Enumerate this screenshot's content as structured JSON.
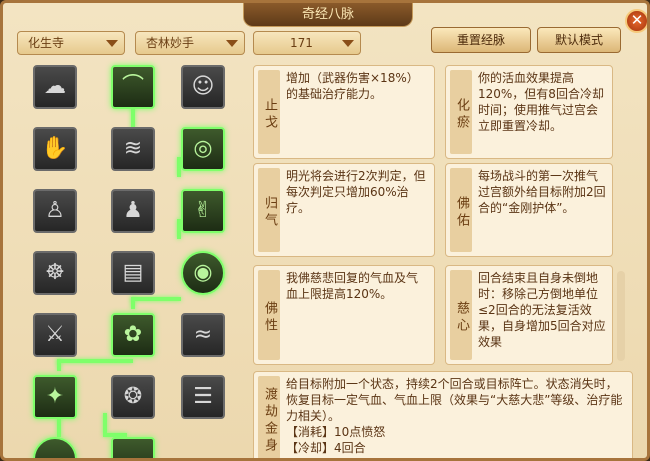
{
  "window": {
    "title": "奇经八脉",
    "close": "✕"
  },
  "filters": [
    {
      "label": "化生寺"
    },
    {
      "label": "杏林妙手"
    },
    {
      "label": "171"
    }
  ],
  "buttons": {
    "reset": "重置经脉",
    "default": "默认模式"
  },
  "skills": [
    {
      "icon": "cloud-icon",
      "glyph": "☁",
      "active": false
    },
    {
      "icon": "green-arch-icon",
      "glyph": "⌒",
      "active": true
    },
    {
      "icon": "monk-icon",
      "glyph": "☺",
      "active": false
    },
    {
      "icon": "hand-icon",
      "glyph": "✋",
      "active": false
    },
    {
      "icon": "jade-ring-icon",
      "glyph": "◎",
      "active": true
    },
    {
      "icon": "wave-icon",
      "glyph": "≋",
      "active": false
    },
    {
      "icon": "buddha-icon",
      "glyph": "♙",
      "active": false
    },
    {
      "icon": "green-hand-icon",
      "glyph": "✌",
      "active": true
    },
    {
      "icon": "figure-icon",
      "glyph": "♟",
      "active": false
    },
    {
      "icon": "meditation-icon",
      "glyph": "☸",
      "active": false
    },
    {
      "icon": "book-icon",
      "glyph": "▤",
      "active": false
    },
    {
      "icon": "halo-icon",
      "glyph": "◉",
      "active": true
    },
    {
      "icon": "sword-icon",
      "glyph": "⚔",
      "active": false
    },
    {
      "icon": "lotus-icon",
      "glyph": "✿",
      "active": true
    },
    {
      "icon": "feather-icon",
      "glyph": "≈",
      "active": false
    },
    {
      "icon": "branch-icon",
      "glyph": "✦",
      "active": true
    },
    {
      "icon": "dragon-icon",
      "glyph": "❂",
      "active": false
    },
    {
      "icon": "scroll-icon",
      "glyph": "☰",
      "active": false
    }
  ],
  "cards": [
    {
      "name": "止戈",
      "desc": "增加（武器伤害×18%）的基础治疗能力。"
    },
    {
      "name": "化瘀",
      "desc": "你的活血效果提高120%，但有8回合冷却时间；使用推气过宫会立即重置冷却。"
    },
    {
      "name": "归气",
      "desc": "明光将会进行2次判定，但每次判定只增加60%治疗。"
    },
    {
      "name": "佛佑",
      "desc": "每场战斗的第一次推气过宫额外给目标附加2回合的“金刚护体”。"
    },
    {
      "name": "佛性",
      "desc": "我佛慈悲回复的气血及气血上限提高120%。"
    },
    {
      "name": "慈心",
      "desc": "回合结束且自身未倒地时：移除己方倒地单位≤2回合的无法复活效果，自身增加5回合对应效果"
    },
    {
      "name": "渡劫金身",
      "desc": "给目标附加一个状态，持续2个回合或目标阵亡。状态消失时，恢复目标一定气血、气血上限（效果与“大慈大悲”等级、治疗能力相关）。"
    },
    {
      "name": "消耗",
      "desc": "【消耗】10点愤怒"
    },
    {
      "name": "冷却",
      "desc": "【冷却】4回合"
    }
  ]
}
